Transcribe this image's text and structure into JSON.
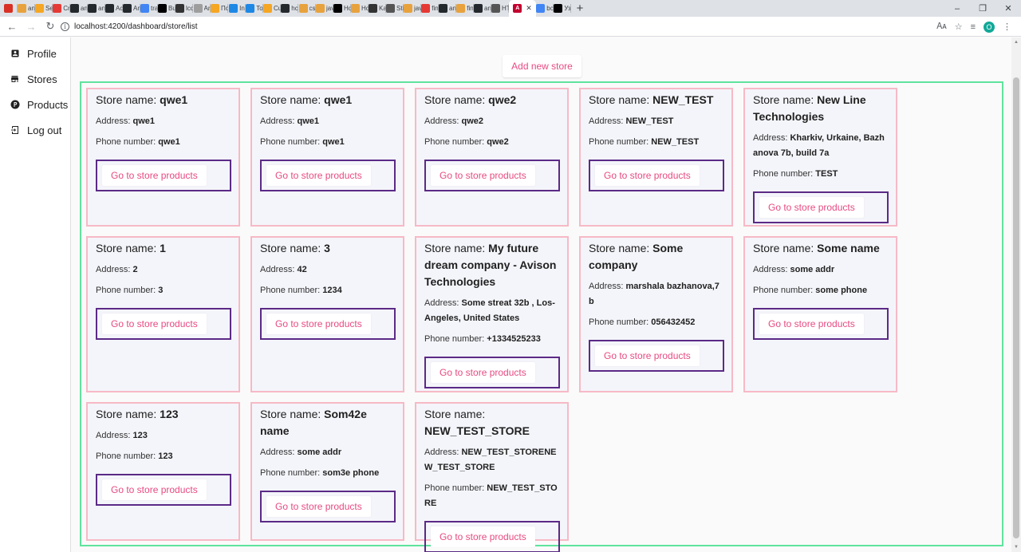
{
  "browser": {
    "tabs": [
      {
        "label": "",
        "icon": "gmail-icon",
        "color": "#d93025"
      },
      {
        "label": "an",
        "icon": "scroll-icon",
        "color": "#e8a23d"
      },
      {
        "label": "Se",
        "icon": "flame-icon",
        "color": "#f5a623"
      },
      {
        "label": "Cr",
        "icon": "cross-icon",
        "color": "#e53935"
      },
      {
        "label": "an",
        "icon": "github-icon",
        "color": "#24292e"
      },
      {
        "label": "an",
        "icon": "github-icon",
        "color": "#24292e"
      },
      {
        "label": "Ac",
        "icon": "github-icon",
        "color": "#24292e"
      },
      {
        "label": "An",
        "icon": "github-icon",
        "color": "#24292e"
      },
      {
        "label": "tra",
        "icon": "google-icon",
        "color": "#4285f4"
      },
      {
        "label": "Bu",
        "icon": "dev-icon",
        "color": "#000000"
      },
      {
        "label": "lcc",
        "icon": "circle-icon",
        "color": "#333333"
      },
      {
        "label": "Ar",
        "icon": "archive-icon",
        "color": "#9e9e9e"
      },
      {
        "label": "Пс",
        "icon": "shield-icon",
        "color": "#f5a623"
      },
      {
        "label": "In",
        "icon": "bolt-icon",
        "color": "#1e88e5"
      },
      {
        "label": "To",
        "icon": "bolt-icon",
        "color": "#1e88e5"
      },
      {
        "label": "Cu",
        "icon": "shield-icon",
        "color": "#f5a623"
      },
      {
        "label": "hc",
        "icon": "github-icon",
        "color": "#24292e"
      },
      {
        "label": "cs",
        "icon": "scroll-icon",
        "color": "#e8a23d"
      },
      {
        "label": "jav",
        "icon": "scroll-icon",
        "color": "#e8a23d"
      },
      {
        "label": "Hc",
        "icon": "bootstrap-icon",
        "color": "#000000"
      },
      {
        "label": "Hc",
        "icon": "scroll-icon",
        "color": "#e8a23d"
      },
      {
        "label": "Ka",
        "icon": "square-icon",
        "color": "#333333"
      },
      {
        "label": "Sti",
        "icon": "globe-icon",
        "color": "#555555"
      },
      {
        "label": "jav",
        "icon": "scroll-icon",
        "color": "#e8a23d"
      },
      {
        "label": "fin",
        "icon": "chart-icon",
        "color": "#e53935"
      },
      {
        "label": "an",
        "icon": "github-icon",
        "color": "#24292e"
      },
      {
        "label": "fin",
        "icon": "scroll-icon",
        "color": "#e8a23d"
      },
      {
        "label": "an",
        "icon": "github-icon",
        "color": "#24292e"
      },
      {
        "label": "HT",
        "icon": "doc-icon",
        "color": "#555555"
      }
    ],
    "active_tab_icon": "angular-icon",
    "after_tabs": [
      {
        "label": "bc",
        "icon": "google-icon",
        "color": "#4285f4"
      },
      {
        "label": "Уз",
        "icon": "video-icon",
        "color": "#000000"
      }
    ],
    "new_tab": "+",
    "url": "localhost:4200/dashboard/store/list",
    "profile_initial": "O",
    "window_controls": [
      "–",
      "❐",
      "✕"
    ]
  },
  "sidebar": {
    "items": [
      {
        "label": "Profile",
        "icon": "account-box-icon"
      },
      {
        "label": "Stores",
        "icon": "store-icon"
      },
      {
        "label": "Products",
        "icon": "product-icon"
      },
      {
        "label": "Log out",
        "icon": "logout-icon"
      }
    ]
  },
  "main": {
    "add_store_label": "Add new store",
    "labels": {
      "store_name": "Store name:",
      "address": "Address:",
      "phone": "Phone number:",
      "goto": "Go to store products"
    },
    "stores": [
      {
        "name": "qwe1",
        "address": "qwe1",
        "phone": "qwe1"
      },
      {
        "name": "qwe1",
        "address": "qwe1",
        "phone": "qwe1"
      },
      {
        "name": "qwe2",
        "address": "qwe2",
        "phone": "qwe2"
      },
      {
        "name": "NEW_TEST",
        "address": "NEW_TEST",
        "phone": "NEW_TEST"
      },
      {
        "name": "New Line Technologies",
        "address": "Kharkiv, Urkaine, Bazhanova 7b, build 7a",
        "phone": "TEST"
      },
      {
        "name": "1",
        "address": "2",
        "phone": "3"
      },
      {
        "name": "3",
        "address": "42",
        "phone": "1234"
      },
      {
        "name": "My future dream company - Avison Technologies",
        "address": "Some streat 32b , Los-Angeles, United States",
        "phone": "+1334525233"
      },
      {
        "name": "Some company",
        "address": "marshala bazhanova,7b",
        "phone": "056432452"
      },
      {
        "name": "Some name",
        "address": "some addr",
        "phone": "some phone"
      },
      {
        "name": "123",
        "address": "123",
        "phone": "123"
      },
      {
        "name": "Som42e name",
        "address": "some addr",
        "phone": "som3e phone"
      },
      {
        "name": "NEW_TEST_STORE",
        "address": "NEW_TEST_STORENEW_TEST_STORE",
        "phone": "NEW_TEST_STORE"
      }
    ]
  },
  "colors": {
    "accent_pink": "#e84a82",
    "card_border": "#f7b9c6",
    "button_border": "#5b2a86",
    "grid_border": "#5fe39d"
  }
}
